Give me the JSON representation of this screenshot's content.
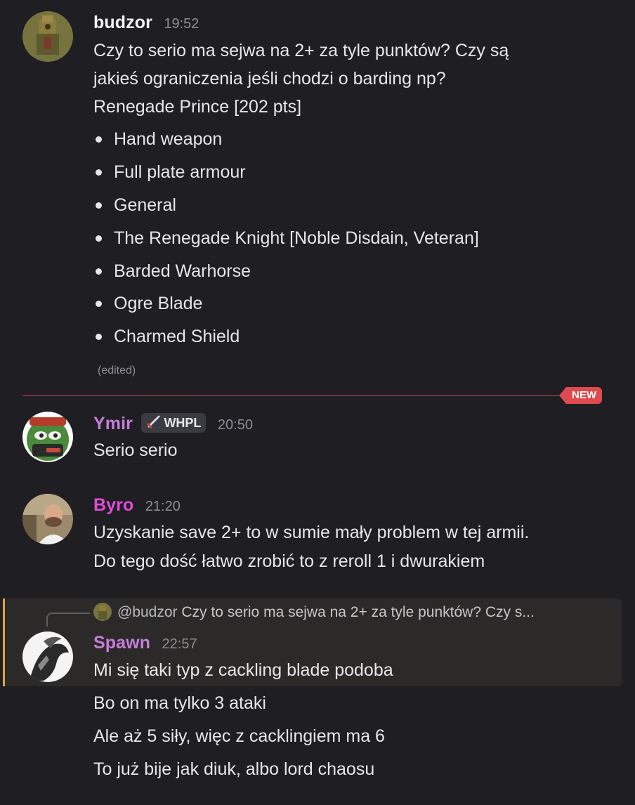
{
  "messages": {
    "budzor": {
      "username": "budzor",
      "username_color": "#f2f3f5",
      "time": "19:52",
      "lines": [
        "Czy to serio ma sejwa na 2+ za tyle punktów? Czy są",
        "jakieś ograniczenia jeśli chodzi o barding np?",
        "Renegade Prince [202 pts]"
      ],
      "list": [
        "Hand weapon",
        "Full plate armour",
        "General",
        "The Renegade Knight [Noble Disdain, Veteran]",
        "Barded Warhorse",
        "Ogre Blade",
        "Charmed Shield"
      ],
      "edited": "(edited)"
    },
    "new_divider_label": "NEW",
    "ymir": {
      "username": "Ymir",
      "username_color": "#c77dd8",
      "role_tag": "WHPL",
      "time": "20:50",
      "lines": [
        "Serio serio"
      ]
    },
    "byro": {
      "username": "Byro",
      "username_color": "#e14bd8",
      "time": "21:20",
      "lines": [
        "Uzyskanie save 2+ to w sumie mały problem w tej armii.",
        "Do tego dość łatwo zrobić to z reroll 1 i dwurakiem"
      ]
    },
    "spawn": {
      "reply_mention": "@budzor",
      "reply_preview": "Czy to serio ma sejwa na 2+ za tyle punktów? Czy s...",
      "username": "Spawn",
      "username_color": "#c77dd8",
      "time": "22:57",
      "lines": [
        "Mi się taki typ z cackling blade podoba",
        "Bo on ma tylko 3 ataki",
        "Ale aż 5 siły, więc z cacklingiem ma 6",
        "To już bije jak diuk, albo lord chaosu"
      ]
    }
  }
}
